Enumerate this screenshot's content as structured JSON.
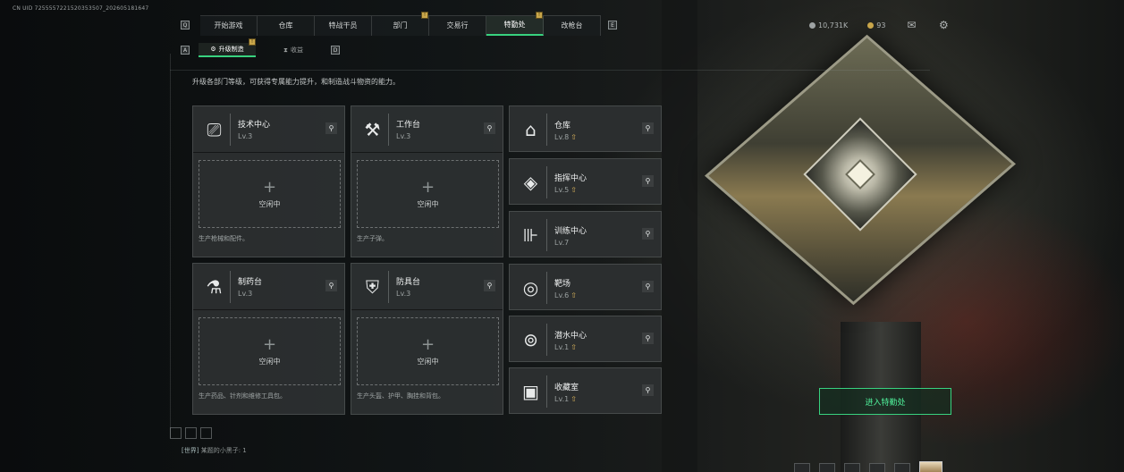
{
  "uid_text": "CN UID 7255557221520353507_202605181647",
  "nav": {
    "left_key": "Q",
    "right_key": "E",
    "tabs": [
      {
        "label": "开始游戏",
        "active": false,
        "badge": ""
      },
      {
        "label": "仓库",
        "active": false,
        "badge": ""
      },
      {
        "label": "特战干员",
        "active": false,
        "badge": ""
      },
      {
        "label": "部门",
        "active": false,
        "badge": "!"
      },
      {
        "label": "交易行",
        "active": false,
        "badge": ""
      },
      {
        "label": "特勤处",
        "active": true,
        "badge": "!"
      },
      {
        "label": "改枪台",
        "active": false,
        "badge": ""
      }
    ]
  },
  "top_right": {
    "currency_1": "10,731K",
    "currency_2": "93",
    "mail_icon": "mail-icon",
    "settings_icon": "gear-icon"
  },
  "subnav": {
    "left_key": "A",
    "right_key": "D",
    "tabs": [
      {
        "label": "升级制造",
        "active": true,
        "badge": "!"
      },
      {
        "label": "收益",
        "active": false,
        "badge": ""
      }
    ]
  },
  "description": "升级各部门等级，可获得专属能力提升，和制造战斗物资的能力。",
  "production_cards": [
    {
      "title": "技术中心",
      "level": "Lv.3",
      "slot_text": "空闲中",
      "footer": "生产枪械和配件。",
      "icon": "tech-center-icon"
    },
    {
      "title": "工作台",
      "level": "Lv.3",
      "slot_text": "空闲中",
      "footer": "生产子弹。",
      "icon": "workbench-icon"
    },
    {
      "title": "制药台",
      "level": "Lv.3",
      "slot_text": "空闲中",
      "footer": "生产药品、针剂和维修工具包。",
      "icon": "pharmacy-icon"
    },
    {
      "title": "防具台",
      "level": "Lv.3",
      "slot_text": "空闲中",
      "footer": "生产头盔、护甲、胸挂和背包。",
      "icon": "armor-bench-icon"
    }
  ],
  "side_cards": [
    {
      "title": "仓库",
      "level": "Lv.8",
      "upgrade": true,
      "icon": "warehouse-icon"
    },
    {
      "title": "指挥中心",
      "level": "Lv.5",
      "upgrade": true,
      "icon": "command-center-icon"
    },
    {
      "title": "训练中心",
      "level": "Lv.7",
      "upgrade": false,
      "icon": "training-center-icon"
    },
    {
      "title": "靶场",
      "level": "Lv.6",
      "upgrade": true,
      "icon": "shooting-range-icon"
    },
    {
      "title": "潜水中心",
      "level": "Lv.1",
      "upgrade": true,
      "icon": "diving-center-icon"
    },
    {
      "title": "收藏室",
      "level": "Lv.1",
      "upgrade": true,
      "icon": "collection-room-icon"
    }
  ],
  "enter_button": "进入特勤处",
  "chat": {
    "channel": "[世界]",
    "message": "某题的小黑子: 1"
  },
  "colors": {
    "accent_green": "#38d27f",
    "badge_gold": "#c9a64a"
  }
}
